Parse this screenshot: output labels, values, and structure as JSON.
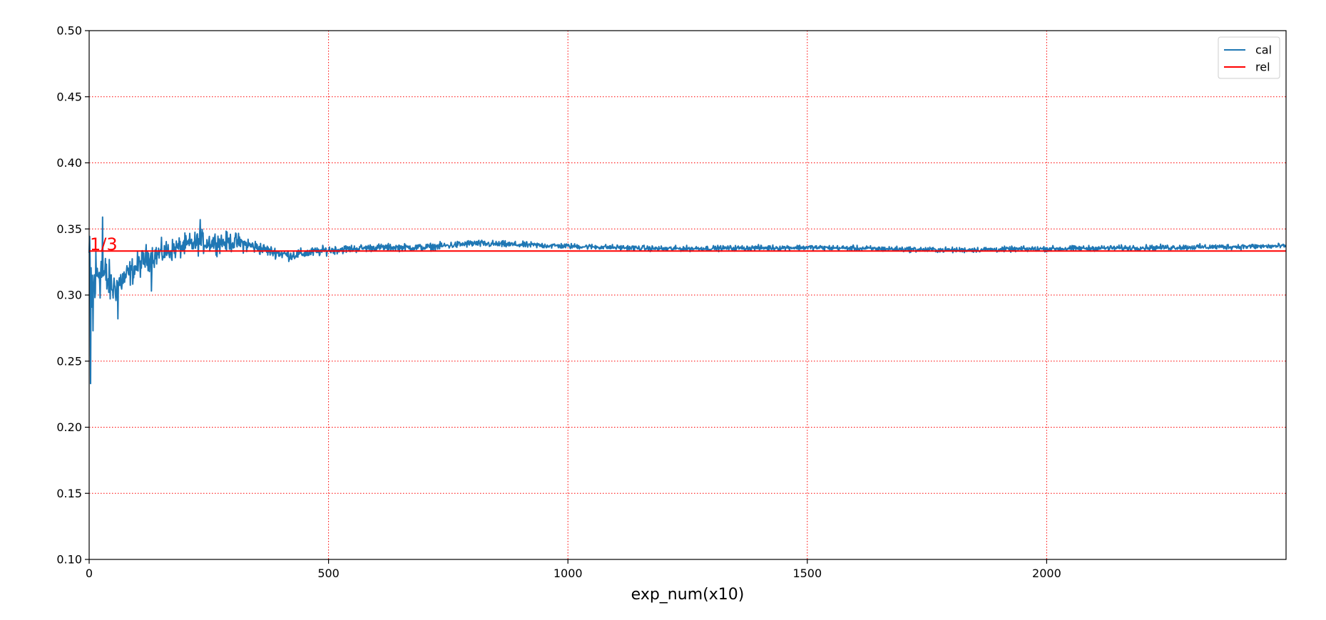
{
  "chart_data": {
    "type": "line",
    "title": "",
    "xlabel": "exp_num(x10)",
    "ylabel": "",
    "xlim": [
      0,
      2500
    ],
    "ylim": [
      0.1,
      0.5
    ],
    "xticks": [
      0,
      500,
      1000,
      1500,
      2000
    ],
    "xtick_labels": [
      "0",
      "500",
      "1000",
      "1500",
      "2000"
    ],
    "yticks": [
      0.1,
      0.15,
      0.2,
      0.25,
      0.3,
      0.35,
      0.4,
      0.45,
      0.5
    ],
    "ytick_labels": [
      "0.10",
      "0.15",
      "0.20",
      "0.25",
      "0.30",
      "0.35",
      "0.40",
      "0.45",
      "0.50"
    ],
    "grid": true,
    "grid_style": "dotted",
    "grid_color": "#ff0000",
    "legend_position": "top-right",
    "series": [
      {
        "name": "cal",
        "color": "#1f77b4",
        "style": "noisy",
        "envelope": [
          {
            "x": 0,
            "center": 0.33,
            "amplitude": 0.03
          },
          {
            "x": 5,
            "center": 0.3,
            "amplitude": 0.06
          },
          {
            "x": 20,
            "center": 0.32,
            "amplitude": 0.035
          },
          {
            "x": 50,
            "center": 0.305,
            "amplitude": 0.02
          },
          {
            "x": 80,
            "center": 0.315,
            "amplitude": 0.015
          },
          {
            "x": 120,
            "center": 0.328,
            "amplitude": 0.015
          },
          {
            "x": 180,
            "center": 0.335,
            "amplitude": 0.012
          },
          {
            "x": 230,
            "center": 0.34,
            "amplitude": 0.013
          },
          {
            "x": 310,
            "center": 0.34,
            "amplitude": 0.01
          },
          {
            "x": 380,
            "center": 0.333,
            "amplitude": 0.006
          },
          {
            "x": 420,
            "center": 0.33,
            "amplitude": 0.006
          },
          {
            "x": 500,
            "center": 0.334,
            "amplitude": 0.005
          },
          {
            "x": 600,
            "center": 0.336,
            "amplitude": 0.004
          },
          {
            "x": 700,
            "center": 0.336,
            "amplitude": 0.004
          },
          {
            "x": 800,
            "center": 0.339,
            "amplitude": 0.004
          },
          {
            "x": 1000,
            "center": 0.337,
            "amplitude": 0.003
          },
          {
            "x": 1200,
            "center": 0.335,
            "amplitude": 0.003
          },
          {
            "x": 1500,
            "center": 0.336,
            "amplitude": 0.003
          },
          {
            "x": 1800,
            "center": 0.334,
            "amplitude": 0.003
          },
          {
            "x": 2000,
            "center": 0.335,
            "amplitude": 0.003
          },
          {
            "x": 2500,
            "center": 0.337,
            "amplitude": 0.003
          }
        ],
        "spikes": [
          {
            "x": 3,
            "y": 0.233
          },
          {
            "x": 8,
            "y": 0.273
          },
          {
            "x": 28,
            "y": 0.359
          },
          {
            "x": 60,
            "y": 0.282
          },
          {
            "x": 130,
            "y": 0.303
          },
          {
            "x": 232,
            "y": 0.357
          }
        ]
      },
      {
        "name": "rel",
        "color": "#ff0000",
        "style": "constant",
        "value": 0.3333
      }
    ],
    "annotations": [
      {
        "text": "1/3",
        "x": 0,
        "y": 0.3333,
        "color": "#ff0000"
      }
    ]
  }
}
